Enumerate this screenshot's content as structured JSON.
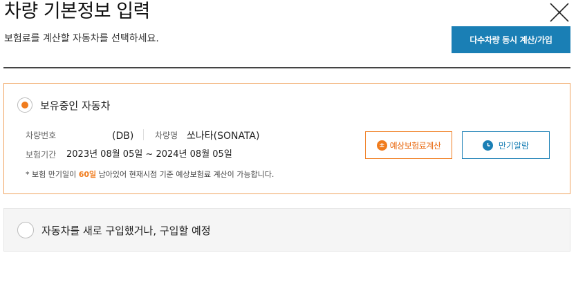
{
  "header": {
    "title": "차량 기본정보 입력",
    "subtitle": "보험료를 계산할 자동차를 선택하세요.",
    "multi_button": "다수차량 동시 계산/가입"
  },
  "owned": {
    "label": "보유중인 자동차",
    "selected": true,
    "plate_label": "차량번호",
    "plate_value": "(DB)",
    "name_label": "차량명",
    "name_value": "쏘나타(SONATA)",
    "period_label": "보험기간",
    "period_value": "2023년 08월 05일 ~ 2024년 08월 05일",
    "notice_prefix": "* 보험 만기일이 ",
    "notice_days": "60일",
    "notice_suffix": " 남아있어 현재시점 기준 예상보험료 계산이 가능합니다.",
    "calc_button": "예상보험료계산",
    "calc_icon_glyph": "±",
    "alarm_button": "만기알람"
  },
  "new_car": {
    "label": "자동차를 새로 구입했거나, 구입할 예정",
    "selected": false
  },
  "colors": {
    "accent_orange": "#f07c1e",
    "accent_blue": "#1a7fb5"
  }
}
